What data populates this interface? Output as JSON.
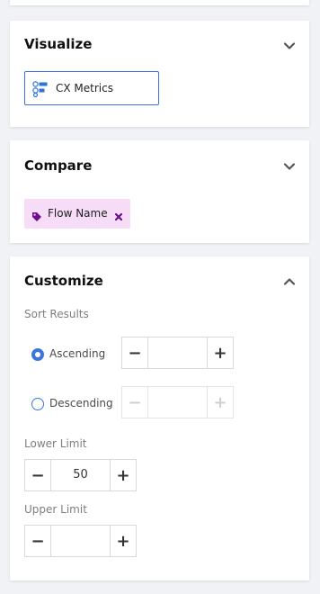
{
  "visualize": {
    "title": "Visualize",
    "selected_metric": "CX Metrics",
    "icon": "metrics-icon"
  },
  "compare": {
    "title": "Compare",
    "chip_label": "Flow Name",
    "chip_color": "#f6dcf6",
    "chip_icon_color": "#6b0f8a"
  },
  "customize": {
    "title": "Customize",
    "sort_label": "Sort Results",
    "ascending_label": "Ascending",
    "descending_label": "Descending",
    "ascending_selected": true,
    "ascending_value": "",
    "descending_value": "",
    "lower_limit_label": "Lower Limit",
    "lower_limit_value": "50",
    "upper_limit_label": "Upper Limit",
    "upper_limit_value": "",
    "minus": "−",
    "plus": "+"
  },
  "colors": {
    "accent": "#3c74e0",
    "chip_bg": "#f6dcf6"
  }
}
